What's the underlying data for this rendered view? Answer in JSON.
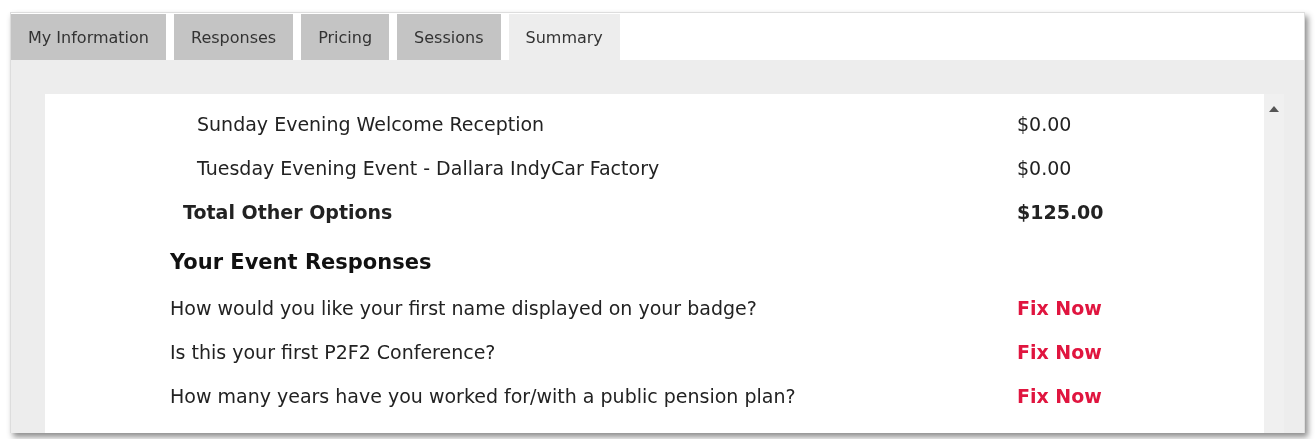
{
  "tabs": [
    {
      "label": "My Information",
      "selected": false
    },
    {
      "label": "Responses",
      "selected": false
    },
    {
      "label": "Pricing",
      "selected": false
    },
    {
      "label": "Sessions",
      "selected": false
    },
    {
      "label": "Summary",
      "selected": true
    }
  ],
  "options": [
    {
      "label": "Sunday Evening Welcome Reception",
      "amount": "$0.00",
      "kind": "item"
    },
    {
      "label": "Tuesday Evening Event - Dallara IndyCar Factory",
      "amount": "$0.00",
      "kind": "item"
    },
    {
      "label": "Total Other Options",
      "amount": "$125.00",
      "kind": "total"
    }
  ],
  "responses": {
    "heading": "Your Event Responses",
    "questions": [
      {
        "text": "How would you like your first name displayed on your badge?",
        "action": "Fix Now"
      },
      {
        "text": "Is this your first P2F2 Conference?",
        "action": "Fix Now"
      },
      {
        "text": "How many years have you worked for/with a public pension plan?",
        "action": "Fix Now"
      }
    ]
  }
}
